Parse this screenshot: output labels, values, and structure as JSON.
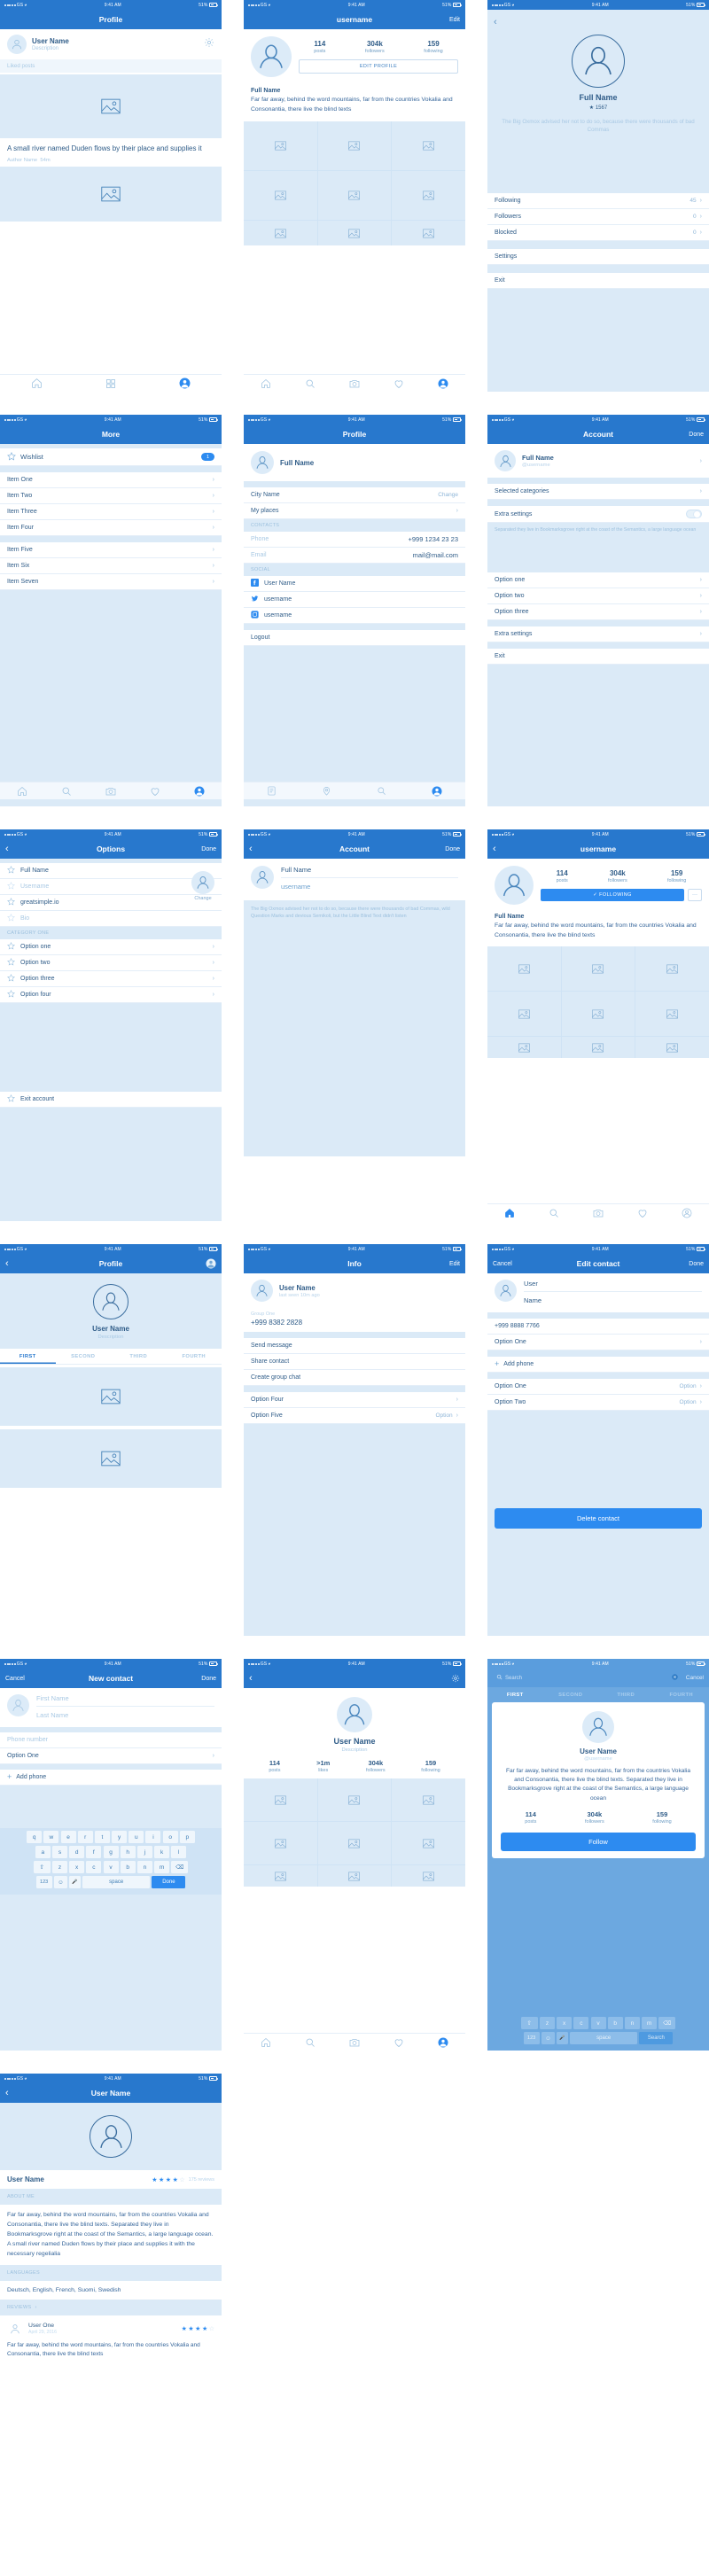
{
  "status_bar": {
    "carrier": "GS",
    "time": "9:41 AM",
    "battery": "51%"
  },
  "screens": {
    "s1_profile": {
      "title": "Profile",
      "user": {
        "name": "User Name",
        "description": "Description"
      },
      "section": "Liked posts",
      "post": {
        "title": "A small river named Duden flows by their place and supplies it",
        "author": "Author Name",
        "time": "54m"
      },
      "tabs": [
        "home-icon",
        "grid-icon",
        "profile-icon"
      ]
    },
    "s2_username": {
      "title": "username",
      "edit": "Edit",
      "stats": [
        {
          "n": "114",
          "l": "posts"
        },
        {
          "n": "304k",
          "l": "followers"
        },
        {
          "n": "159",
          "l": "following"
        }
      ],
      "edit_profile": "EDIT PROFILE",
      "bio_title": "Full Name",
      "bio_text": "Far far away, behind the word mountains, far from the countries Vokalia and Consonantia, there live the blind texts"
    },
    "s3_account": {
      "name": "Full Name",
      "rating": "1567",
      "about": "The Big Oxmox advised her not to do so, because there were thousands of bad Commas",
      "rows": [
        {
          "label": "Following",
          "value": "45"
        },
        {
          "label": "Followers",
          "value": "0"
        },
        {
          "label": "Blocked",
          "value": "0"
        }
      ],
      "settings": "Settings",
      "exit": "Exit"
    },
    "s4_more": {
      "title": "More",
      "wishlist": {
        "label": "Wishlist",
        "badge": "1"
      },
      "items": [
        "Item One",
        "Item Two",
        "Item Three",
        "Item Four",
        "Item Five",
        "Item Six",
        "Item Seven"
      ],
      "tabs": [
        "home-icon",
        "search-icon",
        "camera-icon",
        "heart-icon",
        "profile-icon"
      ]
    },
    "s5_profile": {
      "title": "Profile",
      "name": "Full Name",
      "city": {
        "label": "City Name",
        "action": "Change"
      },
      "places": "My places",
      "contacts_label": "CONTACTS",
      "phone": {
        "label": "Phone",
        "value": "+999 1234 23 23"
      },
      "email": {
        "label": "Email",
        "value": "mail@mail.com"
      },
      "social_label": "SOCIAL",
      "social": [
        {
          "icon": "facebook-icon",
          "value": "User Name"
        },
        {
          "icon": "twitter-icon",
          "value": "username"
        },
        {
          "icon": "instagram-icon",
          "value": "username"
        }
      ],
      "logout": "Logout",
      "tabs": [
        "list-icon",
        "pin-icon",
        "search-icon",
        "profile-icon"
      ]
    },
    "s6_account": {
      "title": "Account",
      "done": "Done",
      "name": "Full Name",
      "handle": "@username",
      "selected_categories": "Selected categories",
      "extra_settings_toggle": "Extra settings",
      "note": "Separated they live in Bookmarksgrove right at the coast of the Semantics, a large language ocean",
      "options": [
        "Option one",
        "Option two",
        "Option three"
      ],
      "extra_settings": "Extra settings",
      "exit": "Exit"
    },
    "s7_options": {
      "title": "Options",
      "done": "Done",
      "fields": [
        {
          "value": "Full Name",
          "placeholder": false
        },
        {
          "value": "Username",
          "placeholder": true
        },
        {
          "value": "greatsimple.io",
          "placeholder": false
        },
        {
          "value": "Bio",
          "placeholder": true
        }
      ],
      "change": "Change",
      "category_label": "CATEGORY ONE",
      "options": [
        "Option one",
        "Option two",
        "Option three",
        "Option four"
      ],
      "exit": "Exit account"
    },
    "s8_account": {
      "title": "Account",
      "done": "Done",
      "name": "Full Name",
      "username": "username",
      "note": "The Big Oxmox advised her not to do so, because there were thousands of bad Commas, wild Question Marks and devious Semikoli, but the Little Blind Text didn't listen"
    },
    "s9_username": {
      "title": "username",
      "stats": [
        {
          "n": "114",
          "l": "posts"
        },
        {
          "n": "304k",
          "l": "followers"
        },
        {
          "n": "159",
          "l": "following"
        }
      ],
      "following_button": "FOLLOWING",
      "more_button": "···",
      "bio_title": "Full Name",
      "bio_text": "Far far away, behind the word mountains, far from the countries Vokalia and Consonantia, there live the blind texts",
      "tabs": [
        "home-icon",
        "search-icon",
        "camera-icon",
        "heart-icon",
        "profile-icon"
      ]
    },
    "s10_profile": {
      "title": "Profile",
      "name": "User Name",
      "description": "Description",
      "tabs": [
        "FIRST",
        "SECOND",
        "THIRD",
        "FOURTH"
      ],
      "active_tab": "FIRST"
    },
    "s11_info": {
      "title": "Info",
      "edit": "Edit",
      "name": "User Name",
      "last_seen": "last seen 10m ago",
      "group_label": "Group One",
      "phone": "+999 8382 2828",
      "actions": [
        "Send message",
        "Share contact",
        "Create group chat"
      ],
      "option_four": "Option Four",
      "option_five": {
        "label": "Option Five",
        "value": "Option"
      }
    },
    "s12_edit_contact": {
      "title": "Edit contact",
      "cancel": "Cancel",
      "done": "Done",
      "first_name": "User",
      "last_name": "Name",
      "phone": "+999 8888 7766",
      "option_one_top": "Option One",
      "add_phone": "Add phone",
      "option_one": {
        "label": "Option One",
        "value": "Option"
      },
      "option_two": {
        "label": "Option Two",
        "value": "Option"
      },
      "delete": "Delete contact"
    },
    "s13_new_contact": {
      "title": "New contact",
      "cancel": "Cancel",
      "done": "Done",
      "first_name_ph": "First Name",
      "last_name_ph": "Last Name",
      "phone_ph": "Phone number",
      "option_one": "Option One",
      "add_phone": "Add phone",
      "keyboard": {
        "row1": [
          "q",
          "w",
          "e",
          "r",
          "t",
          "y",
          "u",
          "i",
          "o",
          "p"
        ],
        "row2": [
          "a",
          "s",
          "d",
          "f",
          "g",
          "h",
          "j",
          "k",
          "l"
        ],
        "row3": [
          "⇧",
          "z",
          "x",
          "c",
          "v",
          "b",
          "n",
          "m",
          "⌫"
        ],
        "row4": [
          "123",
          "☺",
          "🎤",
          "space",
          "Done"
        ]
      }
    },
    "s14_user": {
      "name": "User Name",
      "description": "Description",
      "stats": [
        {
          "n": "114",
          "l": "posts"
        },
        {
          "n": ">1m",
          "l": "likes"
        },
        {
          "n": "304k",
          "l": "followers"
        },
        {
          "n": "159",
          "l": "following"
        }
      ],
      "tabs": [
        "home-icon",
        "search-icon",
        "camera-icon",
        "heart-icon",
        "profile-icon"
      ]
    },
    "s15_search": {
      "search_placeholder": "Search",
      "cancel": "Cancel",
      "tabs": [
        "FIRST",
        "SECOND",
        "THIRD",
        "FOURTH"
      ],
      "active_tab": "FIRST",
      "card": {
        "name": "User Name",
        "handle": "@username",
        "bio": "Far far away, behind the word mountains, far from the countries Vokalia and Consonantia, there live the blind texts. Separated they live in Bookmarksgrove right at the coast of the Semantics, a large language ocean",
        "stats": [
          {
            "n": "114",
            "l": "posts"
          },
          {
            "n": "304k",
            "l": "followers"
          },
          {
            "n": "159",
            "l": "following"
          }
        ],
        "follow": "Follow"
      },
      "keyboard": {
        "row3": [
          "⇧",
          "z",
          "x",
          "c",
          "v",
          "b",
          "n",
          "m",
          "⌫"
        ],
        "row4": [
          "123",
          "☺",
          "🎤",
          "space",
          "Search"
        ]
      }
    },
    "s16_user_name": {
      "title": "User Name",
      "name": "User Name",
      "reviews_count": "175 reviews",
      "rating": 4,
      "about_label": "ABOUT ME",
      "about_text": "Far far away, behind the word mountains, far from the countries Vokalia and Consonantia, there live the blind texts. Separated they live in Bookmarksgrove right at the coast of the Semantics, a large language ocean. A small river named Duden flows by their place and supplies it with the necessary regelialia",
      "languages_label": "LANGUAGES",
      "languages": "Deutsch, English, French, Suomi, Swedish",
      "reviews_label": "REVIEWS",
      "review": {
        "author": "User One",
        "date": "April 29, 2016",
        "rating": 4,
        "text": "Far far away, behind the word mountains, far from the countries Vokalia and Consonantia, there live the blind texts"
      }
    }
  }
}
